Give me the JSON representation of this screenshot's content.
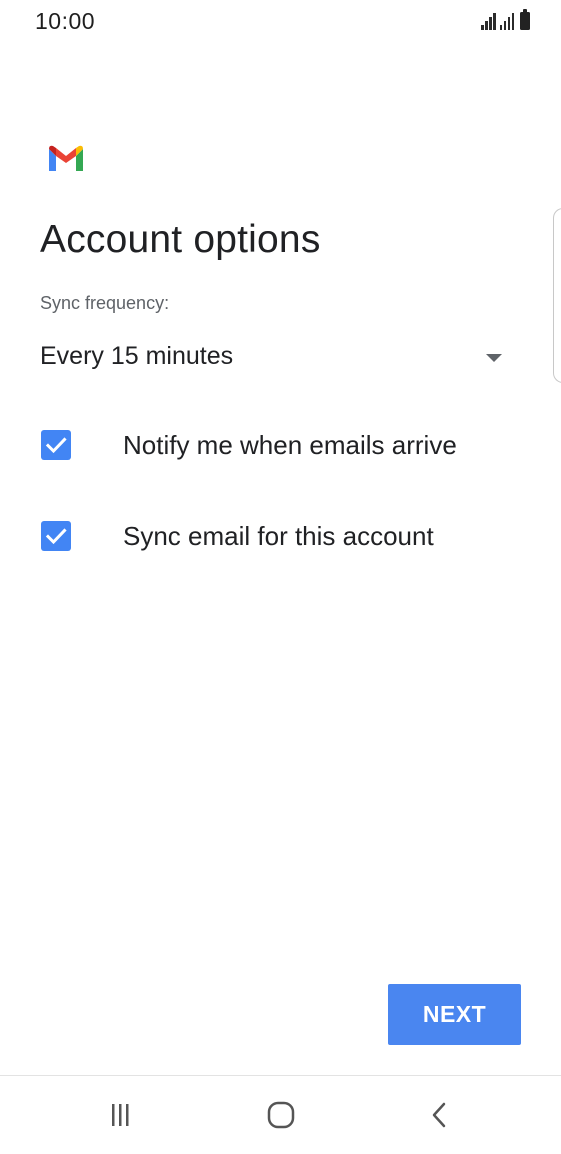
{
  "status_bar": {
    "time": "10:00",
    "icons": [
      "signal-icon",
      "signal-icon",
      "battery-icon"
    ]
  },
  "app": {
    "logo": "gmail-logo",
    "colors": {
      "gmail_red": "#EA4335",
      "gmail_blue": "#4285F4",
      "gmail_green": "#34A853",
      "gmail_yellow": "#FBBC04",
      "gmail_dark_red": "#C5221F",
      "accent": "#4285F4"
    }
  },
  "page": {
    "title": "Account options"
  },
  "sync": {
    "label": "Sync frequency:",
    "selected": "Every 15 minutes",
    "arrow_icon": "dropdown-arrow-icon"
  },
  "options": {
    "notify": {
      "label": "Notify me when emails arrive",
      "checked": true
    },
    "sync_email": {
      "label": "Sync email for this account",
      "checked": true
    }
  },
  "actions": {
    "next_label": "NEXT"
  },
  "nav_bar": {
    "recent_icon": "recent-apps-icon",
    "home_icon": "home-icon",
    "back_icon": "back-icon"
  }
}
